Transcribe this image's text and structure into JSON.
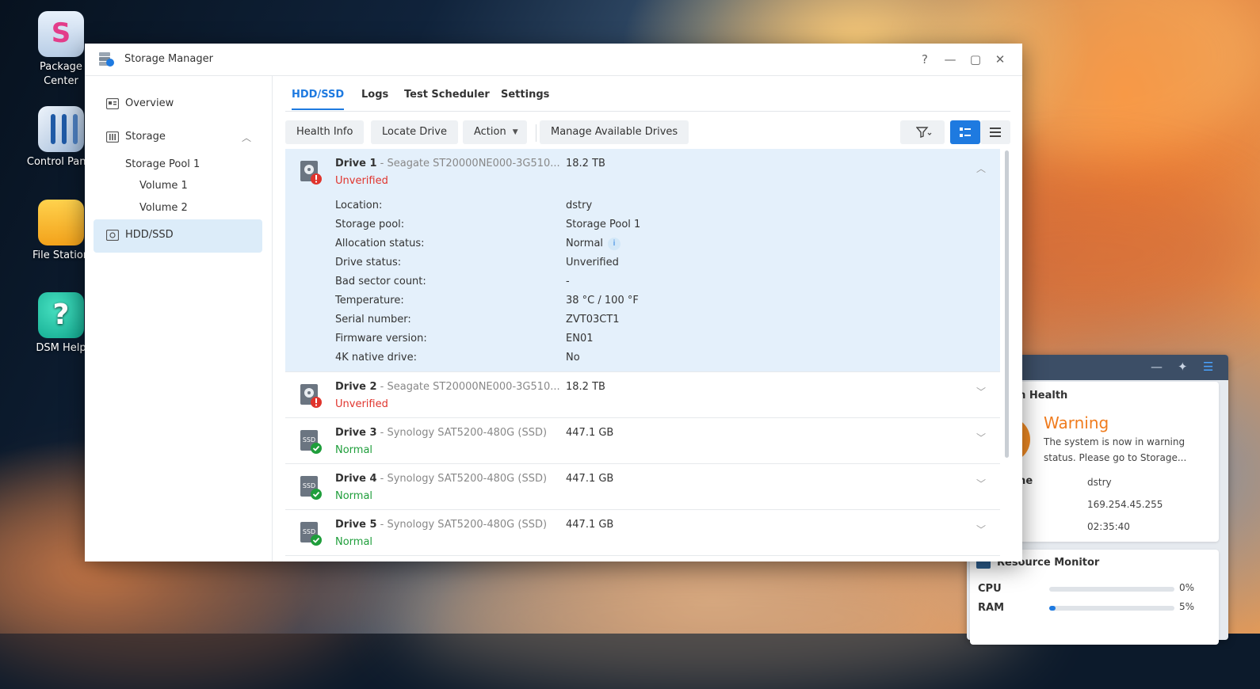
{
  "desktop": {
    "icons": [
      {
        "label": "Package\nCenter",
        "line1": "Package",
        "line2": "Center"
      },
      {
        "label": "Control Panel",
        "line1": "Control Panel"
      },
      {
        "label": "File Station",
        "line1": "File Station"
      },
      {
        "label": "DSM Help",
        "line1": "DSM Help"
      }
    ]
  },
  "health_widget": {
    "title": "em Health",
    "status": "Warning",
    "message_line1": "The system is now in warning",
    "message_line2": "status. Please go to Storage...",
    "rows": [
      {
        "label": "ame",
        "value": "dstry"
      },
      {
        "label": "",
        "value": "169.254.45.255"
      },
      {
        "label": "",
        "value": "02:35:40"
      }
    ]
  },
  "resource_monitor": {
    "title": "Resource Monitor",
    "cpu_label": "CPU",
    "cpu_value": "0%",
    "cpu_fraction": 0.0,
    "ram_label": "RAM",
    "ram_value": "5%",
    "ram_fraction": 0.05
  },
  "window": {
    "title": "Storage Manager",
    "controls": {
      "help": "?",
      "minimize": "—",
      "maximize": "▢",
      "close": "✕"
    }
  },
  "sidebar": {
    "items": [
      {
        "label": "Overview"
      },
      {
        "label": "Storage"
      },
      {
        "label": "HDD/SSD"
      }
    ],
    "sub_items": [
      "Storage Pool 1",
      "Volume 1",
      "Volume 2"
    ]
  },
  "tabs": [
    "HDD/SSD",
    "Logs",
    "Test Scheduler",
    "Settings"
  ],
  "toolbar": {
    "health_info": "Health Info",
    "locate_drive": "Locate Drive",
    "action": "Action",
    "manage_drives": "Manage Available Drives"
  },
  "drives": [
    {
      "name": "Drive 1",
      "model": " - Seagate ST20000NE000-3G510...",
      "size": "18.2 TB",
      "status": "Unverified",
      "state": "warning",
      "kind": "hdd"
    },
    {
      "name": "Drive 2",
      "model": " - Seagate ST20000NE000-3G510...",
      "size": "18.2 TB",
      "status": "Unverified",
      "state": "warning",
      "kind": "hdd"
    },
    {
      "name": "Drive 3",
      "model": " - Synology SAT5200-480G (SSD)",
      "size": "447.1 GB",
      "status": "Normal",
      "state": "ok",
      "kind": "ssd"
    },
    {
      "name": "Drive 4",
      "model": " - Synology SAT5200-480G (SSD)",
      "size": "447.1 GB",
      "status": "Normal",
      "state": "ok",
      "kind": "ssd"
    },
    {
      "name": "Drive 5",
      "model": " - Synology SAT5200-480G (SSD)",
      "size": "447.1 GB",
      "status": "Normal",
      "state": "ok",
      "kind": "ssd"
    }
  ],
  "drive1_details": [
    {
      "label": "Location:",
      "value": "dstry"
    },
    {
      "label": "Storage pool:",
      "value": "Storage Pool 1"
    },
    {
      "label": "Allocation status:",
      "value": "Normal"
    },
    {
      "label": "Drive status:",
      "value": "Unverified"
    },
    {
      "label": "Bad sector count:",
      "value": "-"
    },
    {
      "label": "Temperature:",
      "value": "38 °C / 100 °F"
    },
    {
      "label": "Serial number:",
      "value": "ZVT03CT1"
    },
    {
      "label": "Firmware version:",
      "value": "EN01"
    },
    {
      "label": "4K native drive:",
      "value": "No"
    }
  ],
  "icons": {
    "filter": "filter-icon",
    "card_view": "card-view-icon",
    "list_view": "list-view-icon",
    "overview": "overview-icon",
    "storage": "storage-icon",
    "hdd": "hdd-icon"
  },
  "colors": {
    "accent": "#1e7ae0",
    "warning": "#e0342d",
    "ok": "#1f9e3b",
    "selected_bg": "#e4f0fb"
  }
}
